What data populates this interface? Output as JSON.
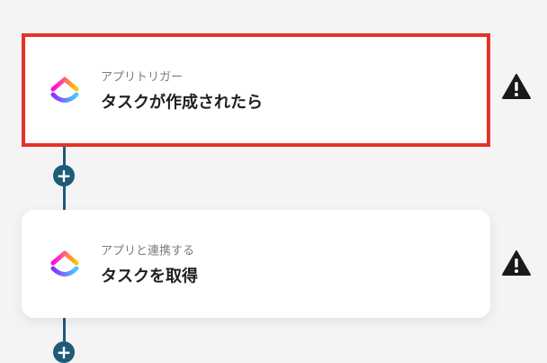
{
  "steps": [
    {
      "subtitle": "アプリトリガー",
      "title": "タスクが作成されたら",
      "icon": "clickup-icon",
      "selected": true
    },
    {
      "subtitle": "アプリと連携する",
      "title": "タスクを取得",
      "icon": "clickup-icon",
      "selected": false
    }
  ],
  "colors": {
    "selection_border": "#e53227",
    "connector": "#1f5b78",
    "warning": "#1a1a1a"
  }
}
